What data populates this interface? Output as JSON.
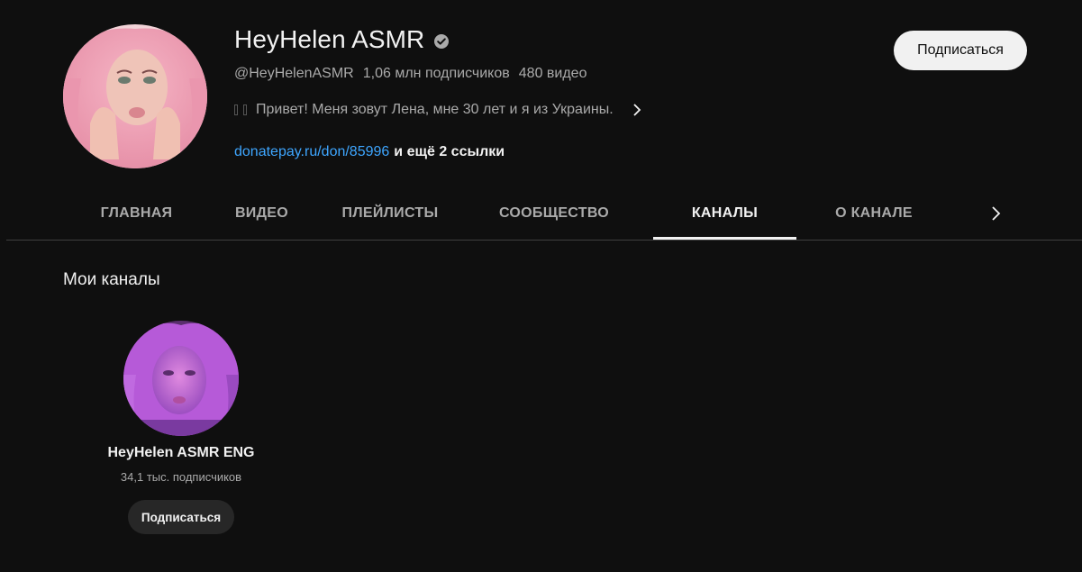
{
  "channel": {
    "name": "HeyHelen ASMR",
    "handle": "@HeyHelenASMR",
    "subscribers": "1,06 млн подписчиков",
    "videos": "480 видео",
    "description": "Привет! Меня зовут Лена, мне 30 лет и я из Украины.",
    "link": "donatepay.ru/don/85996",
    "more_links": "и ещё 2 ссылки",
    "subscribe_label": "Подписаться",
    "verified_icon": "verified-check-icon"
  },
  "tabs": [
    {
      "label": "ГЛАВНАЯ",
      "active": false
    },
    {
      "label": "ВИДЕО",
      "active": false
    },
    {
      "label": "ПЛЕЙЛИСТЫ",
      "active": false
    },
    {
      "label": "СООБЩЕСТВО",
      "active": false
    },
    {
      "label": "КАНАЛЫ",
      "active": true
    },
    {
      "label": "О КАНАЛЕ",
      "active": false
    }
  ],
  "section": {
    "title": "Мои каналы",
    "channels": [
      {
        "name": "HeyHelen ASMR ENG",
        "subscribers": "34,1 тыс. подписчиков",
        "subscribe_label": "Подписаться"
      }
    ]
  },
  "colors": {
    "background": "#0f0f0f",
    "link": "#3ea6ff",
    "secondary_text": "#aaaaaa",
    "primary_text": "#f1f1f1"
  }
}
